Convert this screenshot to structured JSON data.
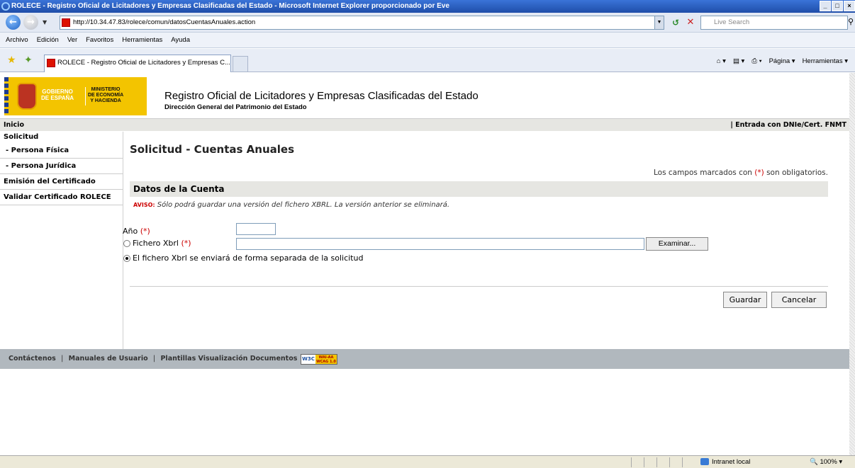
{
  "window": {
    "title": "ROLECE - Registro Oficial de Licitadores y Empresas Clasificadas del Estado - Microsoft Internet Explorer proporcionado por Eve",
    "url": "http://10.34.47.83/rolece/comun/datosCuentasAnuales.action",
    "search_placeholder": "Live Search",
    "tab_title": "ROLECE - Registro Oficial de Licitadores y Empresas C...",
    "controls": [
      "_",
      "□",
      "×"
    ]
  },
  "menu": [
    "Archivo",
    "Edición",
    "Ver",
    "Favoritos",
    "Herramientas",
    "Ayuda"
  ],
  "toolbar": {
    "home": "⌂ ▾",
    "feeds": "▤ ▾",
    "print": "⎙ ▾",
    "page": "Página ▾",
    "tools": "Herramientas ▾"
  },
  "header": {
    "logo_gobierno": "GOBIERNO\nDE ESPAÑA",
    "logo_ministerio": "MINISTERIO\nDE ECONOMÍA\nY HACIENDA",
    "title": "Registro Oficial de Licitadores y Empresas Clasificadas del Estado",
    "subtitle": "Dirección General del Patrimonio del Estado"
  },
  "topnav": {
    "home": "Inicio",
    "login": "| Entrada con DNIe/Cert. FNMT"
  },
  "sidebar": {
    "items": [
      {
        "label": "Solicitud"
      },
      {
        "label": "- Persona Física"
      },
      {
        "label": "- Persona Jurídica"
      },
      {
        "label": "Emisión del Certificado"
      },
      {
        "label": "Validar Certificado ROLECE"
      }
    ]
  },
  "main": {
    "title": "Solicitud - Cuentas Anuales",
    "required_note_pre": "Los campos marcados con",
    "required_mark": "(*)",
    "required_note_post": "son obligatorios.",
    "section_title": "Datos de la Cuenta",
    "aviso_label": "AVISO:",
    "aviso_text": "Sólo podrá guardar una versión del fichero XBRL. La versión anterior se eliminará.",
    "anio_label": "Año",
    "anio_value": "",
    "xbrl_label": "Fichero Xbrl",
    "xbrl_value": "",
    "browse_button": "Examinar...",
    "separate_label": "El fichero Xbrl se enviará de forma separada de la solicitud",
    "radio_selected": "separate",
    "save_button": "Guardar",
    "cancel_button": "Cancelar"
  },
  "footer": {
    "links": [
      "Contáctenos",
      "Manuales de Usuario",
      "Plantillas Visualización Documentos"
    ],
    "badge_w3c": "W3C",
    "badge_wai": "WAI-AA\nWCAG 1.0"
  },
  "status": {
    "zone": "Intranet local",
    "zoom": "100%"
  }
}
